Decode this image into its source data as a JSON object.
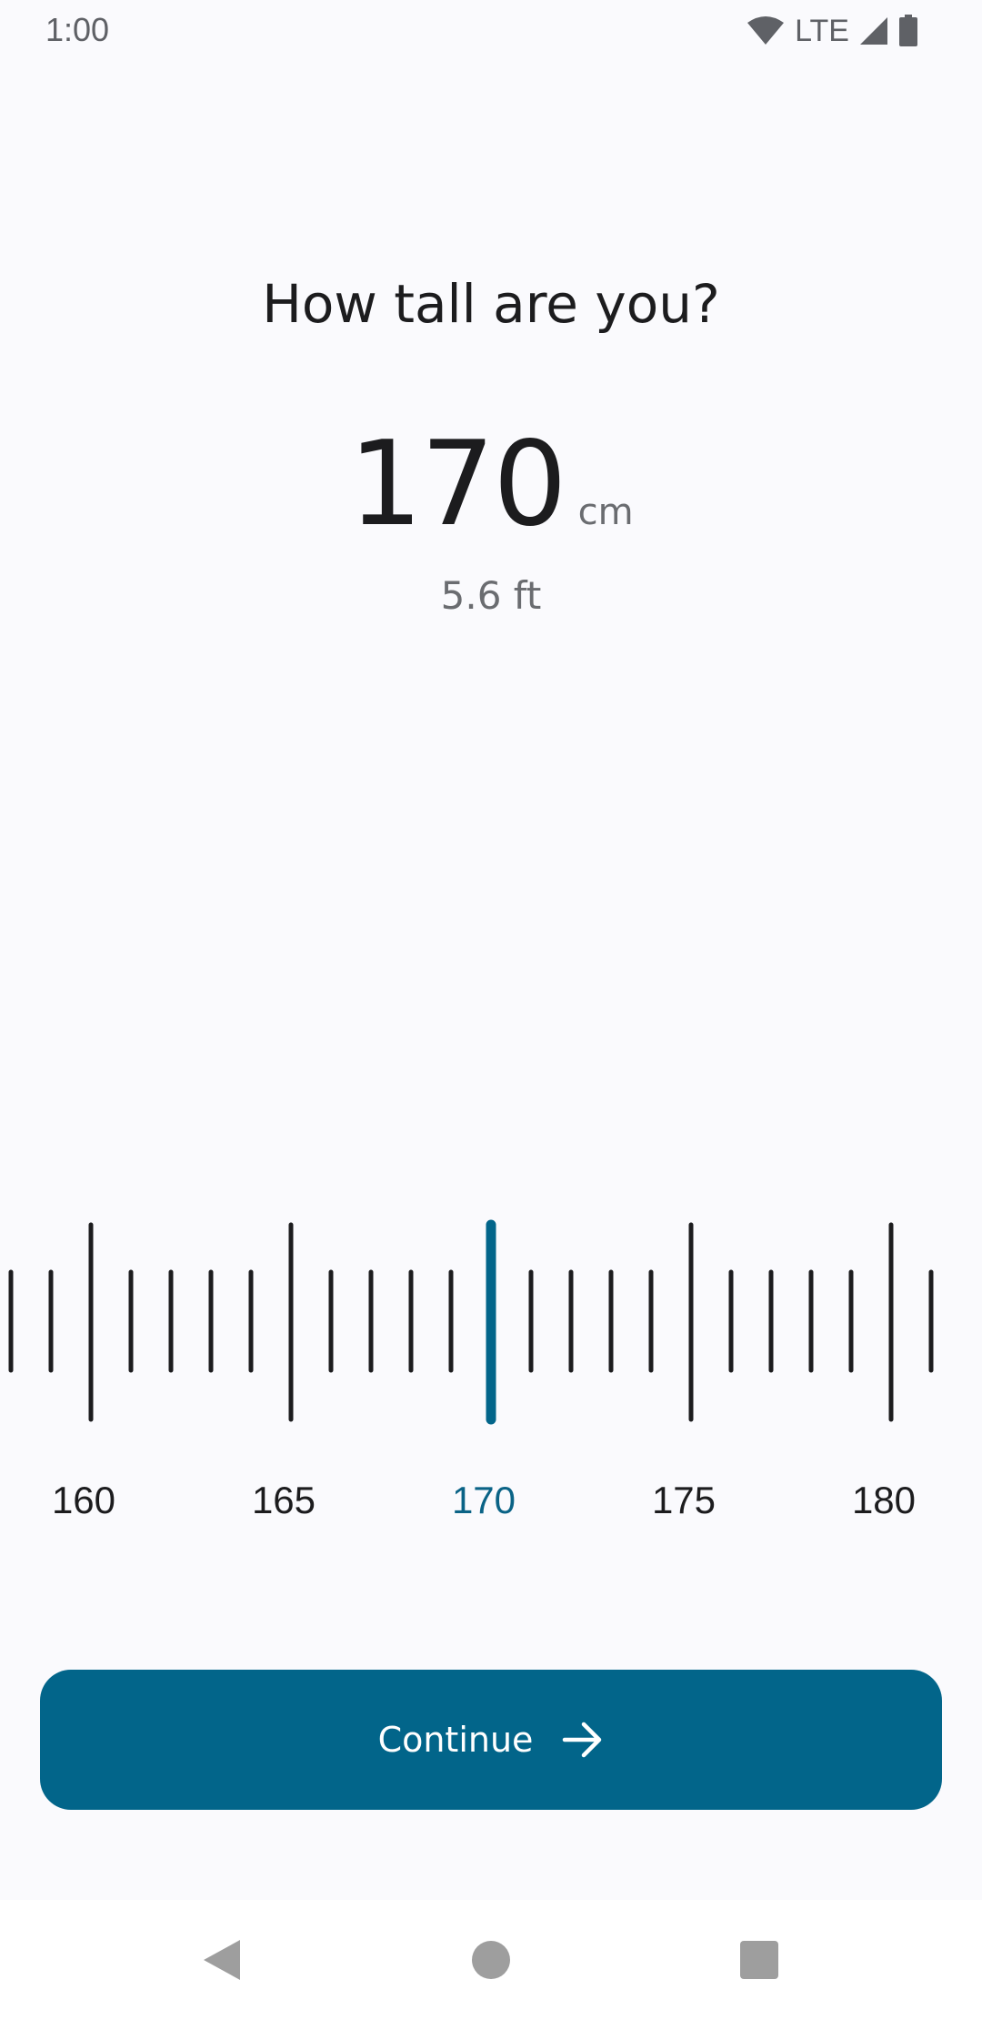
{
  "status_bar": {
    "time": "1:00",
    "network": "LTE",
    "icons": [
      "wifi-icon",
      "signal-icon",
      "battery-icon"
    ]
  },
  "question": "How tall are you?",
  "height": {
    "value": "170",
    "unit": "cm",
    "alt_value": "5.6 ft"
  },
  "ruler": {
    "labels": [
      "160",
      "165",
      "170",
      "175",
      "180"
    ],
    "selected": "170",
    "min_visible": 157,
    "max_visible": 181,
    "accent_color": "#02658a"
  },
  "continue_button": {
    "label": "Continue",
    "icon": "arrow-right-icon"
  },
  "nav": {
    "icons": [
      "back-icon",
      "home-icon",
      "recents-icon"
    ]
  }
}
